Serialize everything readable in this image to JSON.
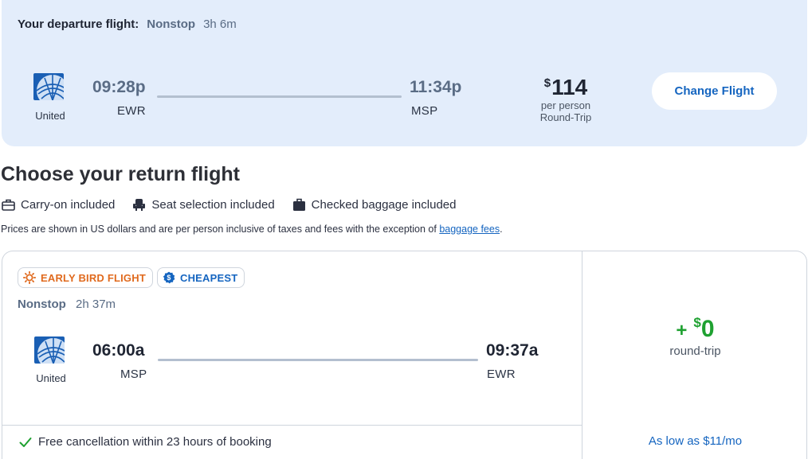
{
  "departure": {
    "label": "Your departure flight:",
    "stops": "Nonstop",
    "duration": "3h 6m",
    "airline": "United",
    "depart_time": "09:28p",
    "depart_code": "EWR",
    "arrive_time": "11:34p",
    "arrive_code": "MSP",
    "price_symbol": "$",
    "price": "114",
    "per_person": "per person",
    "trip_type": "Round-Trip",
    "change_button": "Change Flight"
  },
  "return_section": {
    "title": "Choose your return flight",
    "amenities": [
      {
        "icon": "carry-on-bag-icon",
        "label": "Carry-on included"
      },
      {
        "icon": "seat-icon",
        "label": "Seat selection included"
      },
      {
        "icon": "checked-bag-icon",
        "label": "Checked baggage included"
      }
    ],
    "price_note": "Prices are shown in US dollars and are per person inclusive of taxes and fees with the exception of",
    "price_note_link": "baggage fees",
    "price_note_end": "."
  },
  "return_flight": {
    "badges": [
      {
        "icon": "sun-icon",
        "label": "EARLY BIRD FLIGHT",
        "color": "#e06a1e"
      },
      {
        "icon": "dollar-badge-icon",
        "label": "CHEAPEST",
        "color": "#1565c0"
      }
    ],
    "stops": "Nonstop",
    "duration": "2h 37m",
    "airline": "United",
    "depart_time": "06:00a",
    "depart_code": "MSP",
    "arrive_time": "09:37a",
    "arrive_code": "EWR",
    "price_plus": "+",
    "price_symbol": "$",
    "price": "0",
    "price_sub": "round-trip",
    "free_cancel": "Free cancellation within 23 hours of booking",
    "as_low_as": "As low as $11/mo"
  },
  "colors": {
    "accent_blue": "#1565c0",
    "price_green": "#1fa131",
    "early_orange": "#e06a1e",
    "departure_bg": "#e3edfb"
  }
}
